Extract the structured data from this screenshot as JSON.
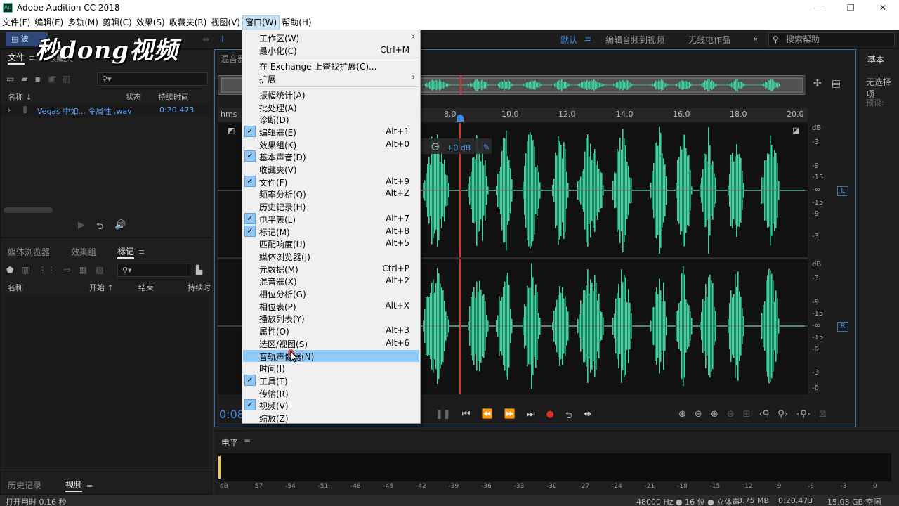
{
  "window": {
    "title": "Adobe Audition CC 2018",
    "controls": [
      "—",
      "❐",
      "✕"
    ]
  },
  "menubar": [
    "文件(F)",
    "编辑(E)",
    "多轨(M)",
    "剪辑(C)",
    "效果(S)",
    "收藏夹(R)",
    "视图(V)",
    "窗口(W)",
    "帮助(H)"
  ],
  "toolbar": {
    "wave_button": "波",
    "workspaces": [
      "默认",
      "编辑音频到视频",
      "无线电作品"
    ],
    "help_search": "搜索帮助"
  },
  "watermark": "秒dong视频",
  "files_panel": {
    "tabs": [
      "文件",
      "收藏夹"
    ],
    "columns": [
      "名称 ↓",
      "状态",
      "持续时间"
    ],
    "file": {
      "name": "Vegas 中如... 令属性 .wav",
      "duration": "0:20.473"
    }
  },
  "markers_panel": {
    "tabs": [
      "媒体浏览器",
      "效果组",
      "标记"
    ],
    "columns": [
      "名称",
      "开始 ↑",
      "结束",
      "持续时"
    ]
  },
  "history_panel": {
    "tabs": [
      "历史记录",
      "视频"
    ]
  },
  "editor": {
    "header": "混音器",
    "time_display": "0:08",
    "ruler_unit": "hms",
    "ruler_ticks": [
      "8.0",
      "10.0",
      "12.0",
      "14.0",
      "16.0",
      "18.0",
      "20.0"
    ],
    "hud_gain": "+0 dB",
    "db_labels_top": [
      "dB",
      "-3",
      "-9",
      "-15",
      "-∞",
      "-15",
      "-9",
      "-3"
    ],
    "db_labels_bottom": [
      "dB",
      "-3",
      "-9",
      "-15",
      "-∞",
      "-15",
      "-9",
      "-3",
      "-0"
    ],
    "channel_left": "L",
    "channel_right": "R",
    "waveform_color": "#3fd0a0"
  },
  "right_panel": {
    "title": "基本",
    "line1": "无选择项",
    "line2": "预设:"
  },
  "levels": {
    "title": "电平",
    "scale": [
      "dB",
      "-57",
      "-54",
      "-51",
      "-48",
      "-45",
      "-42",
      "-39",
      "-36",
      "-33",
      "-30",
      "-27",
      "-24",
      "-21",
      "-18",
      "-15",
      "-12",
      "-9",
      "-6",
      "-3",
      "0"
    ]
  },
  "status": {
    "left": "打开用时 0.16 秒",
    "sample": "48000 Hz ● 16 位 ● 立体声",
    "size": "3.75 MB",
    "duration": "0:20.473",
    "free": "15.03 GB 空闲"
  },
  "window_menu": {
    "items": [
      {
        "label": "工作区(W)",
        "submenu": "›"
      },
      {
        "label": "最小化(C)",
        "shortcut": "Ctrl+M"
      },
      {
        "label": "在 Exchange 上查找扩展(C)..."
      },
      {
        "label": "扩展",
        "submenu": "›"
      },
      {
        "label": "振幅统计(A)"
      },
      {
        "label": "批处理(A)"
      },
      {
        "label": "诊断(D)"
      },
      {
        "label": "编辑器(E)",
        "shortcut": "Alt+1",
        "checked": "✓"
      },
      {
        "label": "效果组(K)",
        "shortcut": "Alt+0"
      },
      {
        "label": "基本声音(D)",
        "checked": "✓"
      },
      {
        "label": "收藏夹(V)"
      },
      {
        "label": "文件(F)",
        "shortcut": "Alt+9",
        "checked": "✓"
      },
      {
        "label": "频率分析(Q)",
        "shortcut": "Alt+Z"
      },
      {
        "label": "历史记录(H)"
      },
      {
        "label": "电平表(L)",
        "shortcut": "Alt+7",
        "checked": "✓"
      },
      {
        "label": "标记(M)",
        "shortcut": "Alt+8",
        "checked": "✓"
      },
      {
        "label": "匹配响度(U)",
        "shortcut": "Alt+5"
      },
      {
        "label": "媒体浏览器(J)"
      },
      {
        "label": "元数据(M)",
        "shortcut": "Ctrl+P"
      },
      {
        "label": "混音器(X)",
        "shortcut": "Alt+2"
      },
      {
        "label": "相位分析(G)"
      },
      {
        "label": "相位表(P)",
        "shortcut": "Alt+X"
      },
      {
        "label": "播放列表(Y)"
      },
      {
        "label": "属性(O)",
        "shortcut": "Alt+3"
      },
      {
        "label": "选区/视图(S)",
        "shortcut": "Alt+6"
      },
      {
        "label": "音轨声像器(N)",
        "highlighted": true
      },
      {
        "label": "时间(I)"
      },
      {
        "label": "工具(T)",
        "checked": "✓"
      },
      {
        "label": "传输(R)"
      },
      {
        "label": "视频(V)",
        "checked": "✓"
      },
      {
        "label": "缩放(Z)"
      }
    ]
  }
}
